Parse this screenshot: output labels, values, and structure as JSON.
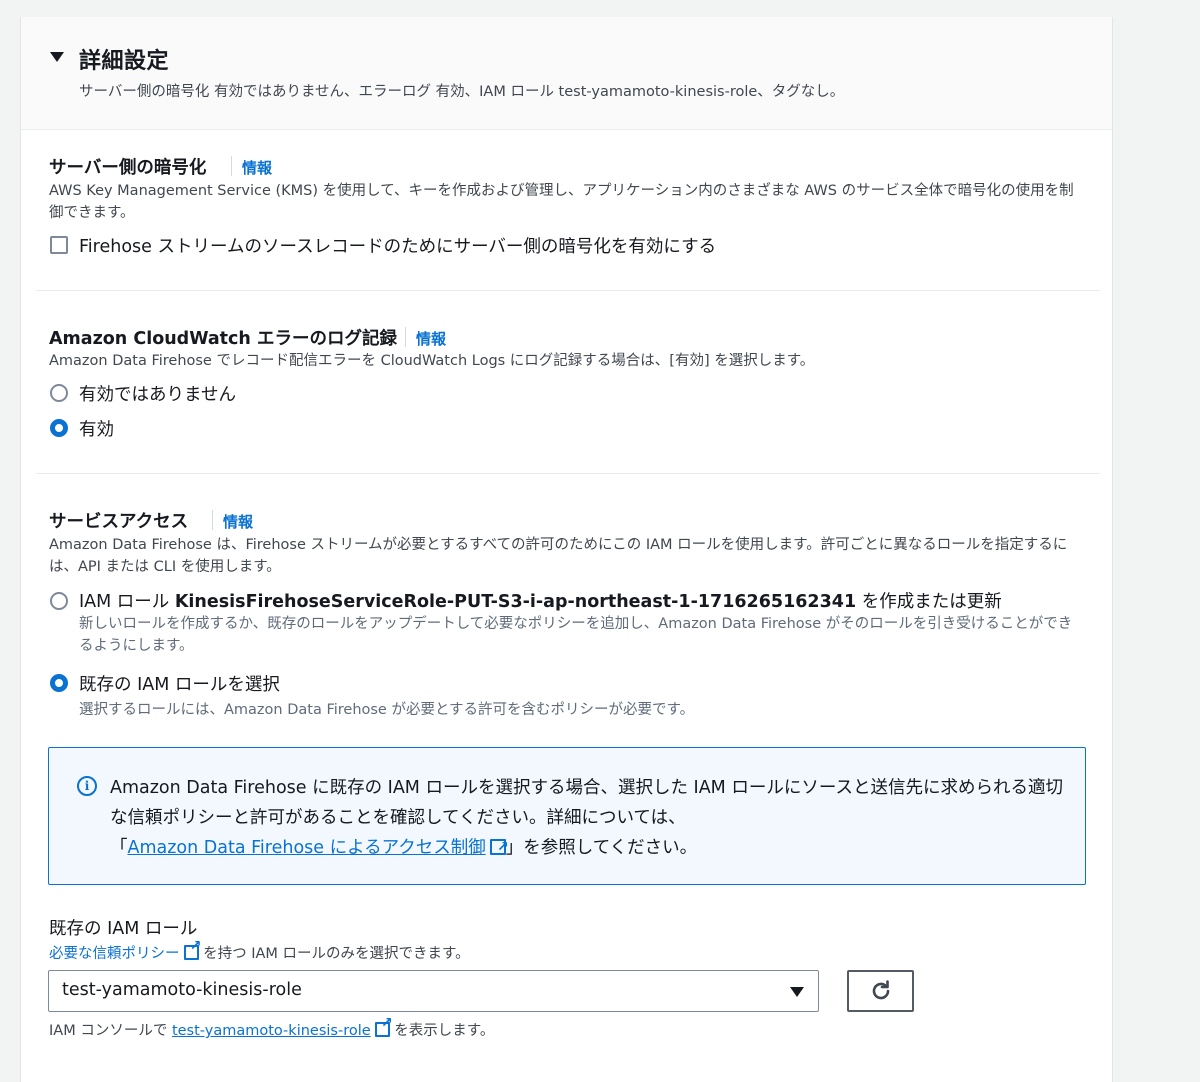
{
  "header": {
    "title": "詳細設定",
    "summary": "サーバー側の暗号化 有効ではありません、エラーログ 有効、IAM ロール test-yamamoto-kinesis-role、タグなし。"
  },
  "encryption": {
    "title": "サーバー側の暗号化",
    "info": "情報",
    "description": "AWS Key Management Service (KMS) を使用して、キーを作成および管理し、アプリケーション内のさまざまな AWS のサービス全体で暗号化の使用を制御できます。",
    "checkbox_label": "Firehose ストリームのソースレコードのためにサーバー側の暗号化を有効にする",
    "checked": false
  },
  "cloudwatch": {
    "title": "Amazon CloudWatch エラーのログ記録",
    "info": "情報",
    "description": "Amazon Data Firehose でレコード配信エラーを CloudWatch Logs にログ記録する場合は、[有効] を選択します。",
    "options": [
      {
        "label": "有効ではありません",
        "selected": false
      },
      {
        "label": "有効",
        "selected": true
      }
    ]
  },
  "service_access": {
    "title": "サービスアクセス",
    "info": "情報",
    "description": "Amazon Data Firehose は、Firehose ストリームが必要とするすべての許可のためにこの IAM ロールを使用します。許可ごとに異なるロールを指定するには、API または CLI を使用します。",
    "option_create": {
      "prefix": "IAM ロール ",
      "role_name": "KinesisFirehoseServiceRole-PUT-S3-i-ap-northeast-1-1716265162341",
      "suffix": " を作成または更新",
      "description": "新しいロールを作成するか、既存のロールをアップデートして必要なポリシーを追加し、Amazon Data Firehose がそのロールを引き受けることができるようにします。",
      "selected": false
    },
    "option_existing": {
      "label": "既存の IAM ロールを選択",
      "description": "選択するロールには、Amazon Data Firehose が必要とする許可を含むポリシーが必要です。",
      "selected": true
    },
    "alert": {
      "line1": "Amazon Data Firehose に既存の IAM ロールを選択する場合、選択した IAM ロールにソースと送信先に求められる適切な信頼ポリシーと許可があることを確認してください。詳細については、",
      "link_open": "「",
      "link_text": "Amazon Data Firehose によるアクセス制御",
      "link_close": "」を参照してください。"
    },
    "existing_role": {
      "label": "既存の IAM ロール",
      "hint_link": "必要な信頼ポリシー",
      "hint_text": " を持つ IAM ロールのみを選択できます。",
      "selected_value": "test-yamamoto-kinesis-role",
      "footer_prefix": "IAM コンソールで ",
      "footer_link": "test-yamamoto-kinesis-role",
      "footer_suffix": " を表示します。"
    }
  },
  "colors": {
    "accent": "#0972d3",
    "alert_bg": "#f2f8fd",
    "text": "#16191f",
    "muted": "#5f6b7a"
  }
}
